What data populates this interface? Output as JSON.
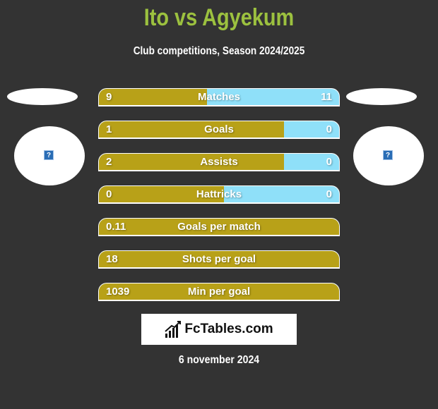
{
  "header": {
    "title": "Ito vs Agyekum",
    "subtitle": "Club competitions, Season 2024/2025"
  },
  "players": {
    "left": {
      "name": "Ito",
      "image_icon": "question-mark-icon"
    },
    "right": {
      "name": "Agyekum",
      "image_icon": "question-mark-icon"
    }
  },
  "colors": {
    "background": "#333333",
    "title": "#9cc13f",
    "left_bar": "#b8a118",
    "right_bar": "#8fe0f9"
  },
  "stats": [
    {
      "label": "Matches",
      "left": "9",
      "right": "11",
      "left_share": 0.45
    },
    {
      "label": "Goals",
      "left": "1",
      "right": "0",
      "left_share": 0.77
    },
    {
      "label": "Assists",
      "left": "2",
      "right": "0",
      "left_share": 0.77
    },
    {
      "label": "Hattricks",
      "left": "0",
      "right": "0",
      "left_share": 0.52
    },
    {
      "label": "Goals per match",
      "left": "0.11",
      "right": "",
      "left_share": 1.0
    },
    {
      "label": "Shots per goal",
      "left": "18",
      "right": "",
      "left_share": 1.0
    },
    {
      "label": "Min per goal",
      "left": "1039",
      "right": "",
      "left_share": 1.0
    }
  ],
  "footer": {
    "logo_text": "FcTables.com",
    "date": "6 november 2024"
  }
}
